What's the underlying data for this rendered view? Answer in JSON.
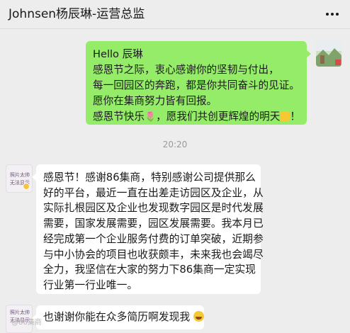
{
  "header": {
    "title": "Johnsen杨辰琳-运营总监",
    "more_icon": "ellipsis-icon"
  },
  "messages": [
    {
      "sender": "self",
      "lines": [
        "Hello 辰琳",
        "感恩节之际，衷心感谢你的坚韧与付出，",
        "每一回园区的奔跑，都是你共同奋斗的见证。",
        "愿你在集商努力皆有回报。",
        "感恩节快乐",
        "，愿我们共创更辉煌的明天",
        "！"
      ],
      "emoji": [
        "tulip-icon",
        "handshake-icon"
      ]
    },
    {
      "sender": "other",
      "lines": [
        "感恩节！感谢86集商，特别感谢公司提供那么",
        "好的平台，最近一直在出差走访园区及企业，从",
        "实际扎根园区及企业也发现数字园区是时代发展",
        "需要，国家发展需要，园区发展需要。我本月已",
        "经完成第一个企业服务付费的订单突破，近期参",
        "与中小协会的项目也收获颇丰，未来我也会竭尽",
        "全力，我坚信在大家的努力下86集商一定实现",
        "行业第一行业唯一。"
      ]
    },
    {
      "sender": "other",
      "text": "也谢谢你能在众多简历啊发现我",
      "emoji": "grinning-sweat-icon"
    }
  ],
  "timestamp": "20:20",
  "avatar_placeholder": {
    "line1": "照片太帅",
    "line2": "无法显示"
  },
  "watermark": "@86集商",
  "colors": {
    "background": "#ededed",
    "self_bubble": "#95ec69",
    "other_bubble": "#ffffff"
  }
}
